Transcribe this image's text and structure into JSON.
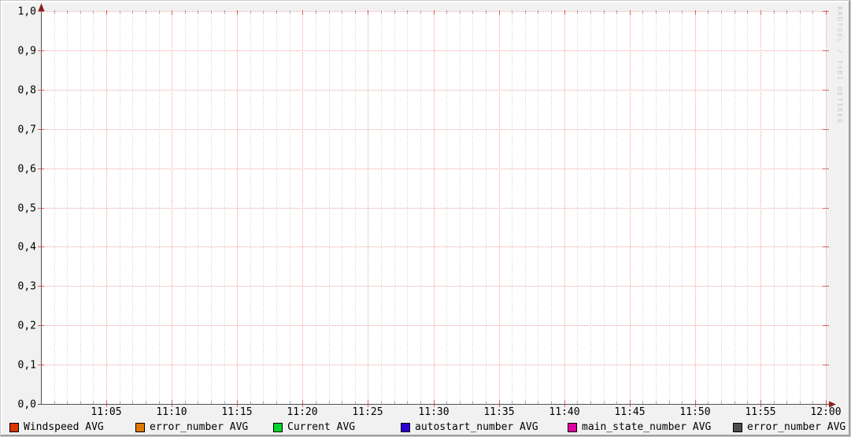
{
  "watermark": "RRDTOOL / TOBI OETIKER",
  "colors": {
    "background": "#f1f1f1",
    "canvas": "#ffffff",
    "major_grid": "#f2a2a2",
    "minor_grid": "#cfcfcf",
    "major_tick": "#d96060",
    "minor_tick": "#a8aebc",
    "axis": "#525252",
    "arrow": "#8b2323",
    "text": "#000000",
    "watermark": "#c6c6c6",
    "bevel_light": "#ffffff",
    "bevel_dark": "#9e9e9e"
  },
  "chart_data": {
    "type": "line",
    "title": "",
    "x_ticks": [
      "11:05",
      "11:10",
      "11:15",
      "11:20",
      "11:25",
      "11:30",
      "11:35",
      "11:40",
      "11:45",
      "11:50",
      "11:55",
      "12:00"
    ],
    "x_minor_per_major": 5,
    "y_ticks": [
      "1,0",
      "0,9",
      "0,8",
      "0,7",
      "0,6",
      "0,5",
      "0,4",
      "0,3",
      "0,2",
      "0,1",
      "0,0"
    ],
    "ylim": [
      0.0,
      1.0
    ],
    "grid": true,
    "legend_position": "bottom",
    "series": [
      {
        "name": "Windspeed AVG",
        "color": "#d93600",
        "values": []
      },
      {
        "name": "error_number AVG",
        "color": "#e07a00",
        "values": []
      },
      {
        "name": "Current AVG",
        "color": "#00d62e",
        "values": []
      },
      {
        "name": "autostart_number AVG",
        "color": "#2e00d6",
        "values": []
      },
      {
        "name": "main_state_number AVG",
        "color": "#e000a1",
        "values": []
      },
      {
        "name": "error_number AVG",
        "color": "#4d4d4d",
        "values": []
      }
    ]
  }
}
